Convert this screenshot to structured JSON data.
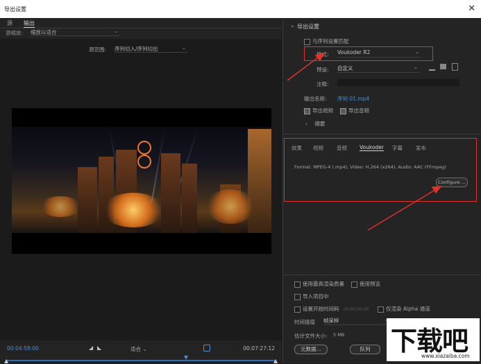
{
  "window": {
    "title": "导出设置",
    "close_glyph": "✕"
  },
  "left_tabs": [
    "源",
    "输出"
  ],
  "source_scaling": {
    "label": "源缩放:",
    "value": "缩放以适合"
  },
  "timeline": {
    "in_timecode": "00:04:58:00",
    "fit_label": "适合",
    "out_timecode": "00:07:27:12",
    "range_label": "源范围:",
    "range_value": "序列切入/序列切出"
  },
  "export_settings": {
    "section_title": "导出设置",
    "match_sequence_label": "与序列设置匹配",
    "format_label": "格式:",
    "format_value": "Voukoder R2",
    "preset_label": "预设:",
    "preset_value": "自定义",
    "comments_label": "注释:",
    "output_name_label": "输出名称:",
    "output_name_value": "序列 01.mp4",
    "export_video_label": "导出视频",
    "export_audio_label": "导出音频",
    "summary_label": "摘要"
  },
  "settings_tabs": [
    "效果",
    "视频",
    "音频",
    "Voukoder",
    "字幕",
    "发布"
  ],
  "settings_tab_active": "Voukoder",
  "format_info": {
    "label": "Format:",
    "value": "MPEG-4 (.mp4), Video: H.264 (x264), Audio: AAC (FFmpeg)"
  },
  "configure_button": "Configure ...",
  "lower_options": {
    "max_render_quality": "使用最高渲染质量",
    "use_previews": "使用预览",
    "import_into_project": "导入项目中",
    "set_start_timecode": "设置开始时间码",
    "start_timecode_value": "00:00:00:00",
    "render_alpha_only": "仅渲染 Alpha 通道",
    "time_interpolation_label": "时间插值",
    "time_interpolation_value": "帧采样",
    "estimated_size_label": "估计文件大小:",
    "estimated_size_value": "5 MB",
    "metadata_button": "元数据...",
    "queue_button": "队列"
  },
  "watermark": {
    "brand": "下载吧",
    "url": "www.xiazaiba.com"
  },
  "colors": {
    "accent_blue": "#4a8fd8",
    "annotation_red": "#e0322a"
  },
  "icons": [
    "close-icon",
    "chevron-down-icon",
    "mark-in-icon",
    "mark-out-icon",
    "playhead-icon",
    "save-preset-icon",
    "import-preset-icon",
    "delete-preset-icon"
  ]
}
